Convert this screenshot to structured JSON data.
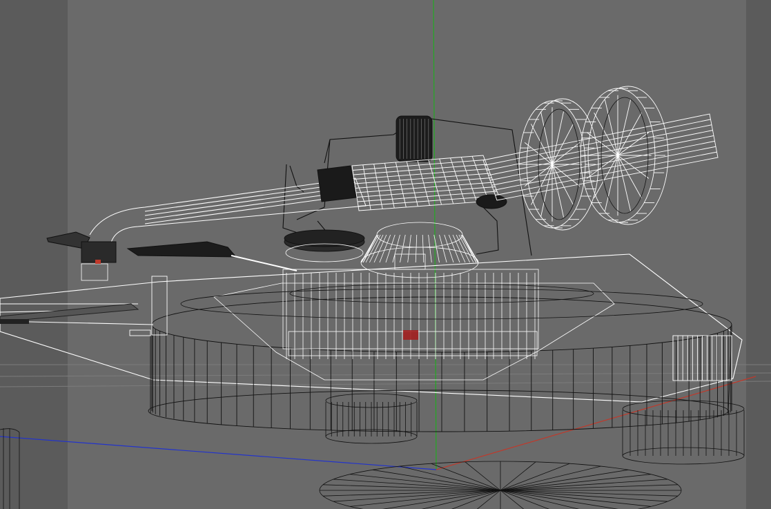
{
  "viewport": {
    "mode": "wireframe",
    "background": "#6a6a6a",
    "safe_frame_shade": "#525252",
    "axis_colors": {
      "x": "#c0392b",
      "y": "#22aa22",
      "z": "#2233cc"
    },
    "wire_colors": {
      "selected": "#ffffff",
      "unselected": "#111111"
    },
    "model": "turntable-tonearm"
  }
}
